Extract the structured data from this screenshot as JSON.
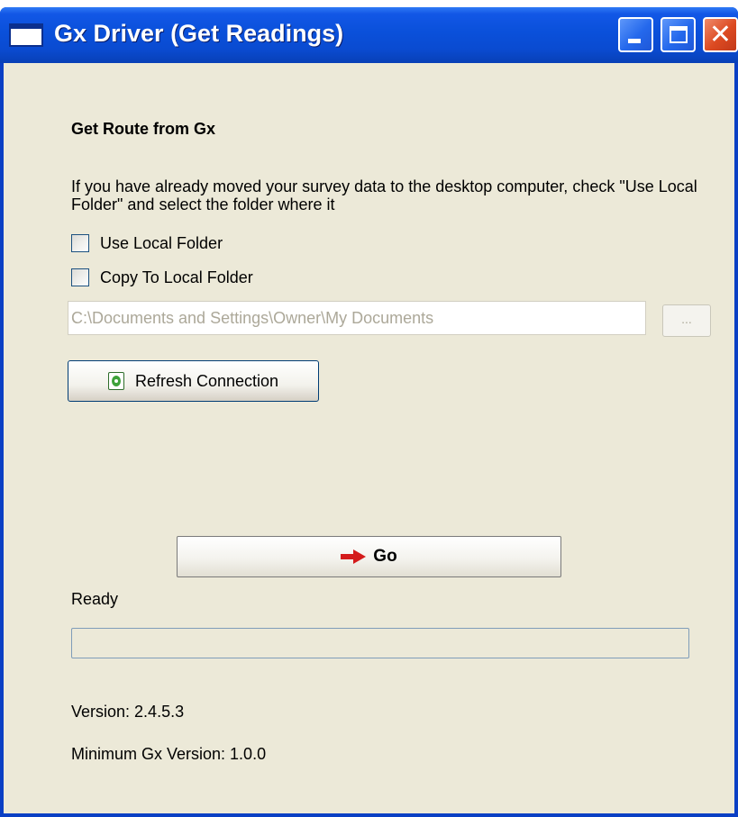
{
  "window": {
    "title": "Gx Driver (Get Readings)"
  },
  "title_buttons": {
    "close_glyph": "✕"
  },
  "main": {
    "heading": "Get Route from Gx",
    "description": "If you have already moved your survey data to the desktop computer, check \"Use Local Folder\" and select the folder where it",
    "use_local_folder": {
      "label": "Use Local Folder",
      "checked": false
    },
    "copy_to_local_folder": {
      "label": "Copy To Local Folder",
      "checked": false
    },
    "folder_path": {
      "value": "C:\\Documents and Settings\\Owner\\My Documents",
      "disabled": true
    },
    "browse_label": "...",
    "refresh_label": "Refresh Connection",
    "go_label": "Go",
    "status": "Ready",
    "progress": 0,
    "version": "Version: 2.4.5.3",
    "min_version": "Minimum Gx Version: 1.0.0"
  },
  "colors": {
    "title_bar": "#0A50DA",
    "client_bg": "#ECE9D8",
    "disabled_text": "#ACA899",
    "go_arrow": "#D41B1B"
  },
  "icons": [
    "app-window-icon",
    "minimize-icon",
    "maximize-icon",
    "close-icon",
    "refresh-icon",
    "arrow-right-icon"
  ]
}
